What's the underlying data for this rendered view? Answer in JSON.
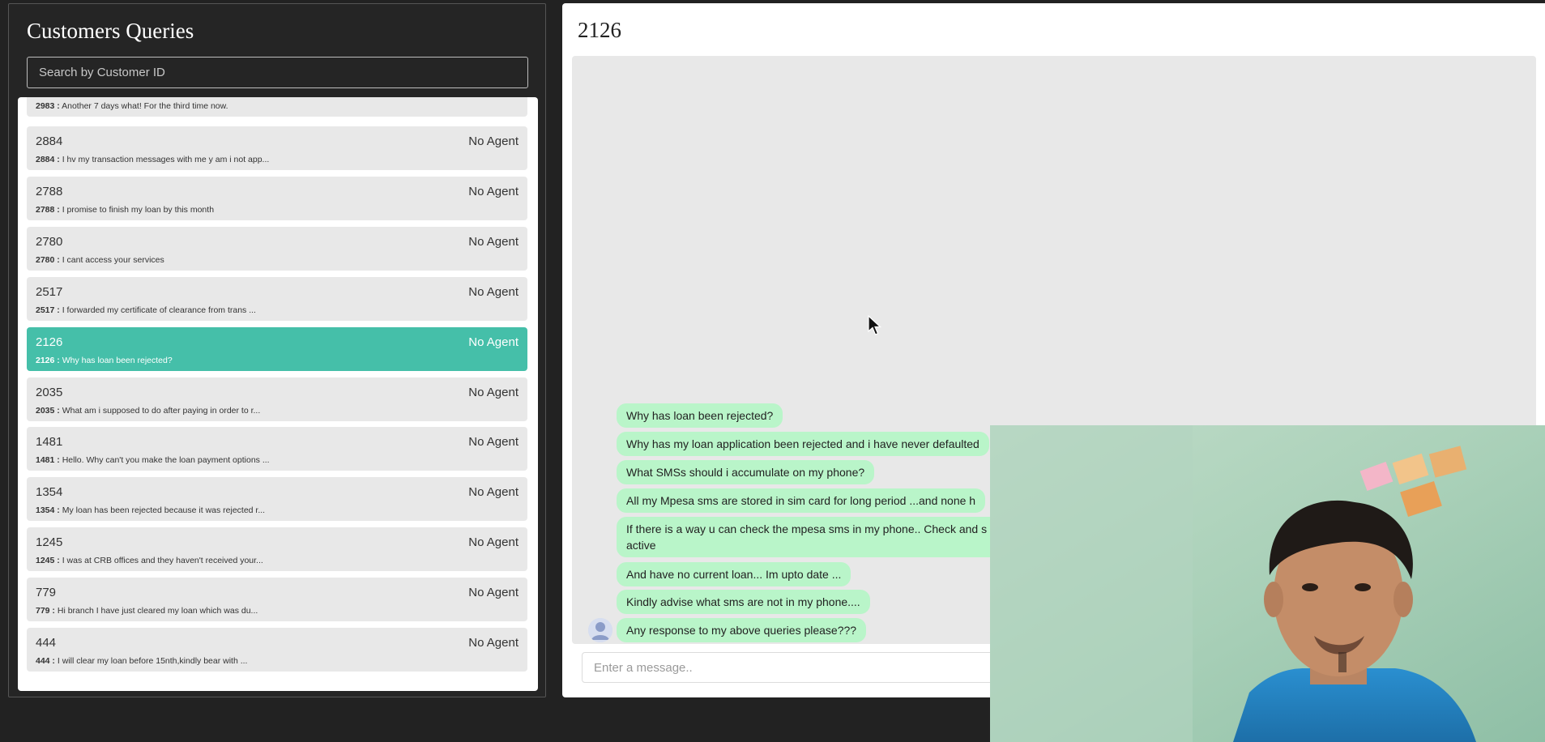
{
  "sidebar": {
    "title": "Customers Queries",
    "search_placeholder": "Search by Customer ID",
    "items": [
      {
        "id": "2983",
        "agent": "",
        "preview_prefix": "2983 :",
        "preview": "Another 7 days what! For the third time now.",
        "selected": false
      },
      {
        "id": "2884",
        "agent": "No Agent",
        "preview_prefix": "2884 :",
        "preview": "I hv my transaction messages with me y am i not app...",
        "selected": false
      },
      {
        "id": "2788",
        "agent": "No Agent",
        "preview_prefix": "2788 :",
        "preview": "I promise to finish my loan by this month",
        "selected": false
      },
      {
        "id": "2780",
        "agent": "No Agent",
        "preview_prefix": "2780 :",
        "preview": "I cant access your services",
        "selected": false
      },
      {
        "id": "2517",
        "agent": "No Agent",
        "preview_prefix": "2517 :",
        "preview": "I forwarded my certificate of clearance from trans ...",
        "selected": false
      },
      {
        "id": "2126",
        "agent": "No Agent",
        "preview_prefix": "2126 :",
        "preview": "Why has loan been rejected?",
        "selected": true
      },
      {
        "id": "2035",
        "agent": "No Agent",
        "preview_prefix": "2035 :",
        "preview": "What am i supposed to do after paying in order to r...",
        "selected": false
      },
      {
        "id": "1481",
        "agent": "No Agent",
        "preview_prefix": "1481 :",
        "preview": "Hello. Why can't you make the loan payment options ...",
        "selected": false
      },
      {
        "id": "1354",
        "agent": "No Agent",
        "preview_prefix": "1354 :",
        "preview": "My loan has been rejected because it was rejected r...",
        "selected": false
      },
      {
        "id": "1245",
        "agent": "No Agent",
        "preview_prefix": "1245 :",
        "preview": "I was at CRB offices and they haven't received your...",
        "selected": false
      },
      {
        "id": "779",
        "agent": "No Agent",
        "preview_prefix": "779 :",
        "preview": "Hi branch I have just cleared my loan which was du...",
        "selected": false
      },
      {
        "id": "444",
        "agent": "No Agent",
        "preview_prefix": "444 :",
        "preview": "I will clear my loan before 15nth,kindly bear with ...",
        "selected": false
      }
    ]
  },
  "chat": {
    "title": "2126",
    "messages": [
      "Why has loan been rejected?",
      "Why has my loan application been rejected and i have never defaulted",
      "What SMSs should i accumulate on my phone?",
      "All my Mpesa sms are stored in sim card for long period ...and none h",
      "If there is a way u can check the mpesa sms in my phone.. Check and s is very active",
      "And have no current loan... Im upto date ...",
      "Kindly advise what sms are not in my phone....",
      "Any response to my above queries please???"
    ],
    "input_placeholder": "Enter a message.."
  },
  "colors": {
    "selected_item": "#45bfa9",
    "bubble": "#b9f5c9",
    "background": "#222222"
  }
}
